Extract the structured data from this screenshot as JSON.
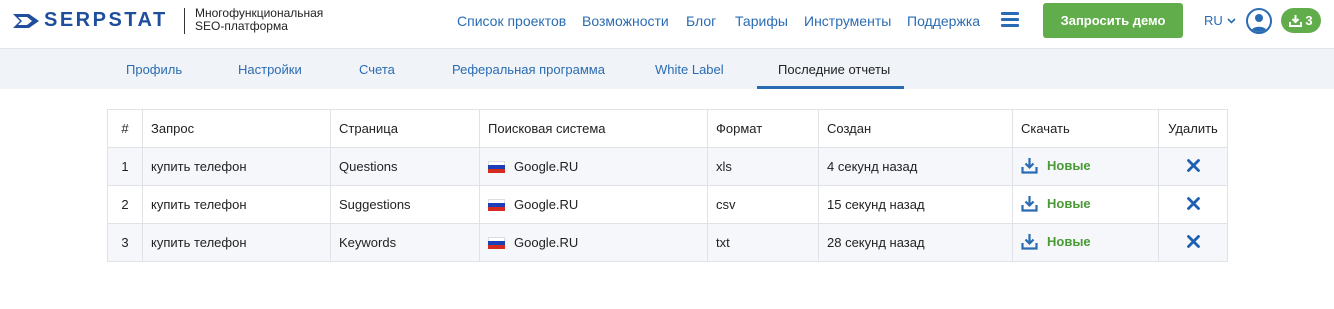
{
  "header": {
    "logo_text": "SERPSTAT",
    "tagline_line1": "Многофункциональная",
    "tagline_line2": "SEO-платформа",
    "nav": [
      "Список проектов",
      "Возможности",
      "Блог",
      "Тарифы",
      "Инструменты",
      "Поддержка"
    ],
    "demo_button": "Запросить демо",
    "language": "RU",
    "downloads_count": "3"
  },
  "tabs": {
    "items": [
      "Профиль",
      "Настройки",
      "Счета",
      "Реферальная программа",
      "White Label",
      "Последние отчеты"
    ],
    "active_index": 5
  },
  "reports": {
    "columns": [
      "#",
      "Запрос",
      "Страница",
      "Поисковая система",
      "Формат",
      "Создан",
      "Скачать",
      "Удалить"
    ],
    "rows": [
      {
        "num": "1",
        "query": "купить телефон",
        "page": "Questions",
        "engine": "Google.RU",
        "format": "xls",
        "created": "4 секунд назад",
        "download": "Новые"
      },
      {
        "num": "2",
        "query": "купить телефон",
        "page": "Suggestions",
        "engine": "Google.RU",
        "format": "csv",
        "created": "15 секунд назад",
        "download": "Новые"
      },
      {
        "num": "3",
        "query": "купить телефон",
        "page": "Keywords",
        "engine": "Google.RU",
        "format": "txt",
        "created": "28 секунд назад",
        "download": "Новые"
      }
    ]
  },
  "icons": {
    "menu": "hamburger-icon",
    "avatar": "user-icon",
    "download": "download-icon",
    "delete": "close-icon",
    "flag": "russia-flag-icon"
  },
  "colors": {
    "brand_blue": "#1f4e9c",
    "link_blue": "#2a6cb3",
    "accent_green": "#62ad4b",
    "delete_blue": "#1d5fb0"
  }
}
